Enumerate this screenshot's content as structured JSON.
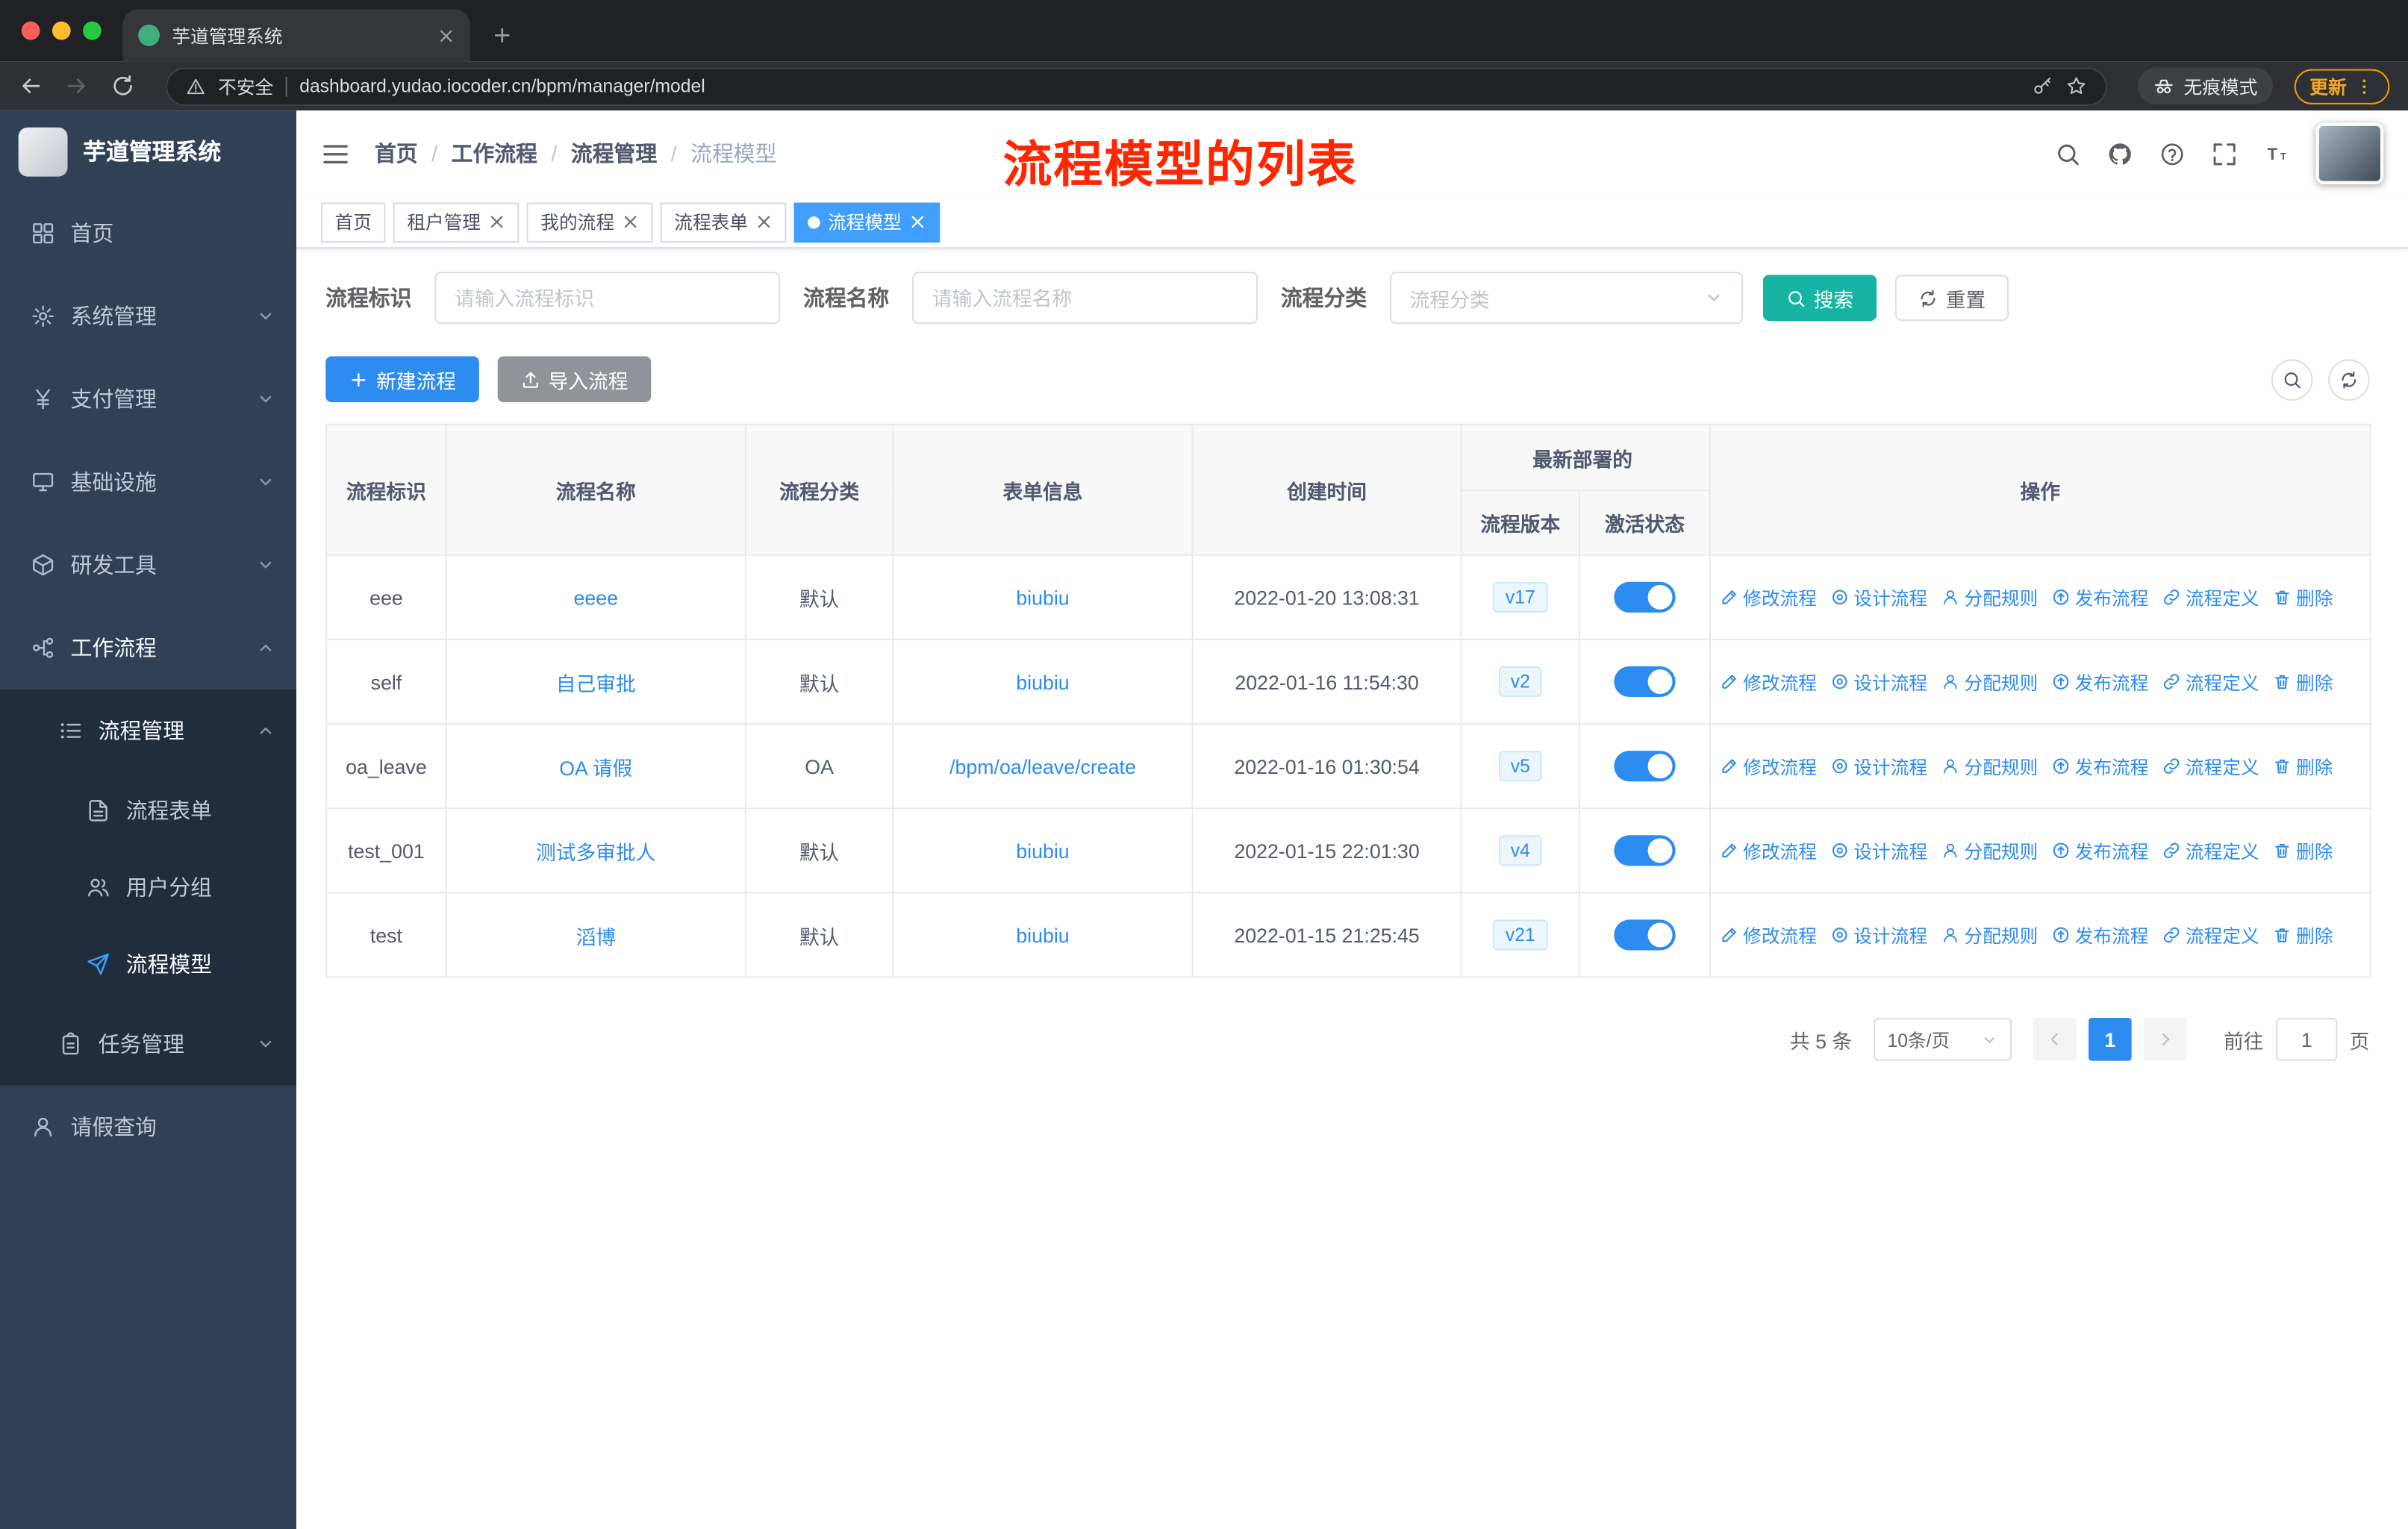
{
  "colors": {
    "accent": "#2d8cf0",
    "menu_active": "#409eff",
    "search_button": "#17b3a3",
    "sidebar_bg": "#304156",
    "annotation_red": "#ff2600"
  },
  "browser": {
    "tab_title": "芋道管理系统",
    "security_label": "不安全",
    "url": "dashboard.yudao.iocoder.cn/bpm/manager/model",
    "incognito_label": "无痕模式",
    "update_label": "更新"
  },
  "annotation": "流程模型的列表",
  "sidebar": {
    "logo_title": "芋道管理系统",
    "items": [
      {
        "label": "首页"
      },
      {
        "label": "系统管理"
      },
      {
        "label": "支付管理"
      },
      {
        "label": "基础设施"
      },
      {
        "label": "研发工具"
      },
      {
        "label": "工作流程"
      },
      {
        "label": "流程管理"
      },
      {
        "label": "流程表单"
      },
      {
        "label": "用户分组"
      },
      {
        "label": "流程模型"
      },
      {
        "label": "任务管理"
      },
      {
        "label": "请假查询"
      }
    ]
  },
  "breadcrumb": {
    "items": [
      "首页",
      "工作流程",
      "流程管理",
      "流程模型"
    ],
    "separator": "/"
  },
  "tags": [
    {
      "label": "首页"
    },
    {
      "label": "租户管理"
    },
    {
      "label": "我的流程"
    },
    {
      "label": "流程表单"
    },
    {
      "label": "流程模型"
    }
  ],
  "filters": {
    "id_label": "流程标识",
    "id_placeholder": "请输入流程标识",
    "name_label": "流程名称",
    "name_placeholder": "请输入流程名称",
    "category_label": "流程分类",
    "category_placeholder": "流程分类",
    "search_label": "搜索",
    "reset_label": "重置"
  },
  "toolbar": {
    "create_label": "新建流程",
    "import_label": "导入流程"
  },
  "table": {
    "headers": {
      "id": "流程标识",
      "name": "流程名称",
      "category": "流程分类",
      "form": "表单信息",
      "created": "创建时间",
      "deploy_group": "最新部署的",
      "version": "流程版本",
      "active": "激活状态",
      "actions": "操作"
    },
    "action_labels": [
      "修改流程",
      "设计流程",
      "分配规则",
      "发布流程",
      "流程定义",
      "删除"
    ],
    "rows": [
      {
        "id": "eee",
        "name": "eeee",
        "category": "默认",
        "form": "biubiu",
        "created": "2022-01-20 13:08:31",
        "version": "v17",
        "active": true
      },
      {
        "id": "self",
        "name": "自己审批",
        "category": "默认",
        "form": "biubiu",
        "created": "2022-01-16 11:54:30",
        "version": "v2",
        "active": true
      },
      {
        "id": "oa_leave",
        "name": "OA 请假",
        "category": "OA",
        "form": "/bpm/oa/leave/create",
        "created": "2022-01-16 01:30:54",
        "version": "v5",
        "active": true
      },
      {
        "id": "test_001",
        "name": "测试多审批人",
        "category": "默认",
        "form": "biubiu",
        "created": "2022-01-15 22:01:30",
        "version": "v4",
        "active": true
      },
      {
        "id": "test",
        "name": "滔博",
        "category": "默认",
        "form": "biubiu",
        "created": "2022-01-15 21:25:45",
        "version": "v21",
        "active": true
      }
    ]
  },
  "pagination": {
    "total": "共 5 条",
    "page_size": "10条/页",
    "current_page": "1",
    "goto_label": "前往",
    "goto_value": "1",
    "page_unit": "页"
  }
}
